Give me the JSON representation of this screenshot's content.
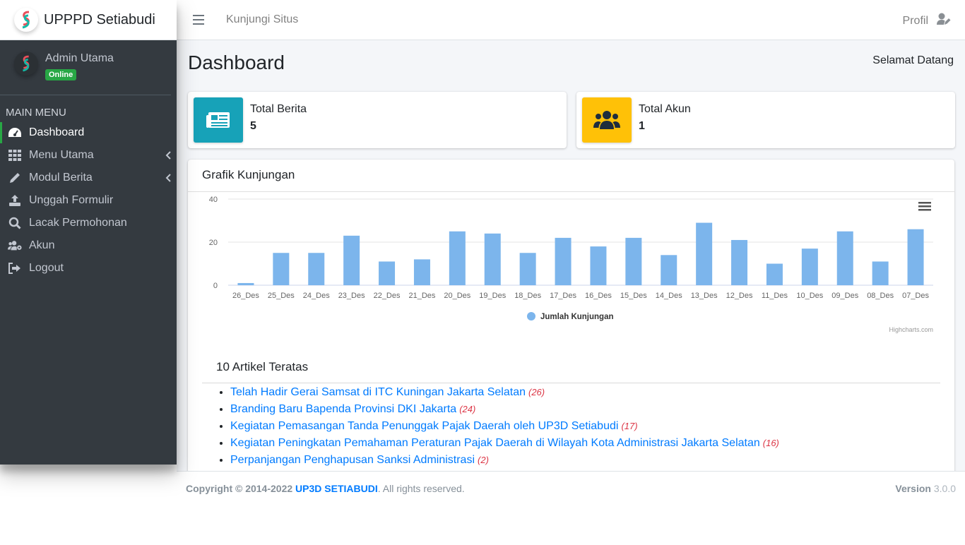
{
  "app": {
    "brand": "UPPPD Setiabudi"
  },
  "user": {
    "name": "Admin Utama",
    "status": "Online"
  },
  "sidebar": {
    "header": "MAIN MENU",
    "items": [
      {
        "label": "Dashboard",
        "icon": "tachometer-icon"
      },
      {
        "label": "Menu Utama",
        "icon": "grid-icon"
      },
      {
        "label": "Modul Berita",
        "icon": "pencil-icon"
      },
      {
        "label": "Unggah Formulir",
        "icon": "upload-icon"
      },
      {
        "label": "Lacak Permohonan",
        "icon": "search-icon"
      },
      {
        "label": "Akun",
        "icon": "users-cog-icon"
      },
      {
        "label": "Logout",
        "icon": "sign-out-icon"
      }
    ]
  },
  "topbar": {
    "visit": "Kunjungi Situs",
    "profile": "Profil"
  },
  "page": {
    "title": "Dashboard",
    "welcome": "Selamat Datang"
  },
  "stats": [
    {
      "label": "Total Berita",
      "value": "5",
      "color": "#17a2b8"
    },
    {
      "label": "Total Akun",
      "value": "1",
      "color": "#ffc107"
    }
  ],
  "chart_card": {
    "title": "Grafik Kunjungan",
    "credits": "Highcharts.com"
  },
  "chart_data": {
    "type": "bar",
    "categories": [
      "26_Des",
      "25_Des",
      "24_Des",
      "23_Des",
      "22_Des",
      "21_Des",
      "20_Des",
      "19_Des",
      "18_Des",
      "17_Des",
      "16_Des",
      "15_Des",
      "14_Des",
      "13_Des",
      "12_Des",
      "11_Des",
      "10_Des",
      "09_Des",
      "08_Des",
      "07_Des"
    ],
    "series": [
      {
        "name": "Jumlah Kunjungan",
        "values": [
          1,
          15,
          15,
          23,
          11,
          12,
          25,
          24,
          15,
          22,
          18,
          22,
          14,
          29,
          21,
          10,
          17,
          25,
          11,
          26
        ]
      }
    ],
    "yticks": [
      "0",
      "20",
      "40"
    ],
    "ylim": [
      0,
      40
    ],
    "color": "#7cb5ec",
    "legend": "bottom"
  },
  "top_articles": {
    "title": "10 Artikel Teratas",
    "items": [
      {
        "title": "Telah Hadir Gerai Samsat di ITC Kuningan Jakarta Selatan",
        "count": "(26)"
      },
      {
        "title": "Branding Baru Bapenda Provinsi DKI Jakarta",
        "count": "(24)"
      },
      {
        "title": "Kegiatan Pemasangan Tanda Penunggak Pajak Daerah oleh UP3D Setiabudi",
        "count": "(17)"
      },
      {
        "title": "Kegiatan Peningkatan Pemahaman Peraturan Pajak Daerah di Wilayah Kota Administrasi Jakarta Selatan",
        "count": "(16)"
      },
      {
        "title": "Perpanjangan Penghapusan Sanksi Administrasi",
        "count": "(2)"
      }
    ]
  },
  "footer": {
    "copyright": "Copyright © 2014-2022",
    "brand": "UP3D SETIABUDI",
    "rights": ". All rights reserved.",
    "version_label": "Version",
    "version": "3.0.0"
  }
}
